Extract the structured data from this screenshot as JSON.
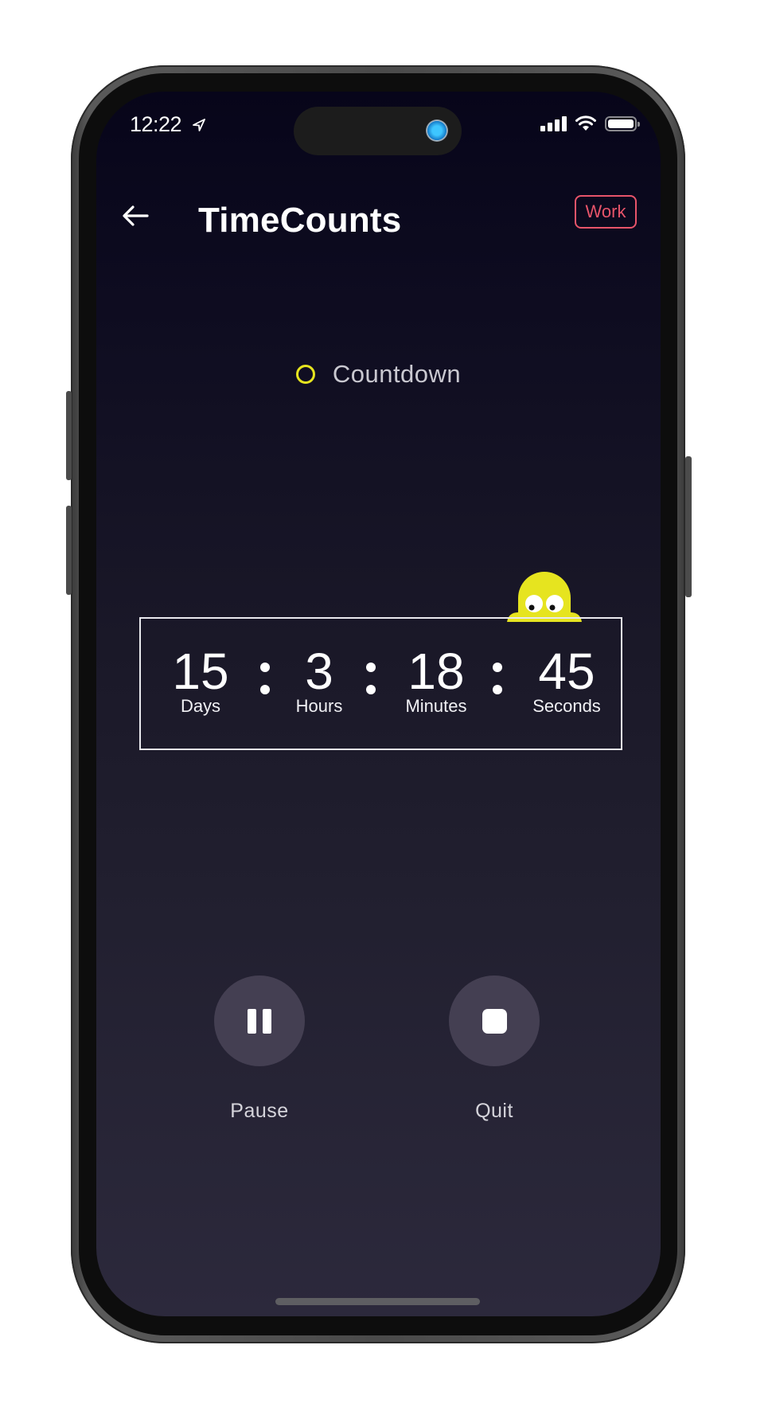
{
  "status_bar": {
    "time": "12:22",
    "location_icon": "location-arrow-icon",
    "signal_icon": "cellular-signal-icon",
    "wifi_icon": "wifi-icon",
    "battery_icon": "battery-full-icon"
  },
  "header": {
    "back_icon": "arrow-left-icon",
    "title": "TimeCounts",
    "category_tag": "Work"
  },
  "mode": {
    "icon": "ring-icon",
    "label": "Countdown"
  },
  "timer": {
    "units": [
      {
        "value": "15",
        "label": "Days"
      },
      {
        "value": "3",
        "label": "Hours"
      },
      {
        "value": "18",
        "label": "Minutes"
      },
      {
        "value": "45",
        "label": "Seconds"
      }
    ],
    "separator": ":"
  },
  "controls": {
    "pause": {
      "label": "Pause",
      "icon": "pause-icon"
    },
    "quit": {
      "label": "Quit",
      "icon": "stop-icon"
    }
  },
  "colors": {
    "accent_yellow": "#e6e41f",
    "tag_red": "#e8546a",
    "button_bg": "#443f52",
    "bg_top": "#07051a",
    "bg_bottom": "#2c293c"
  }
}
